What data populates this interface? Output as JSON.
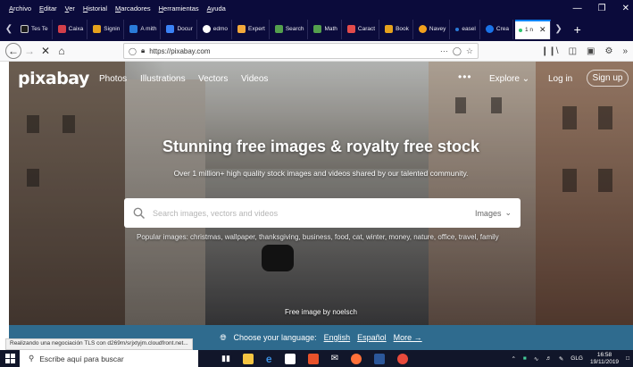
{
  "menubar": {
    "items": [
      "Archivo",
      "Editar",
      "Ver",
      "Historial",
      "Marcadores",
      "Herramientas",
      "Ayuda"
    ]
  },
  "tabs": [
    {
      "label": "Tes Te",
      "color": "#1b1b1b"
    },
    {
      "label": "Caixa",
      "color": "#d23f4a"
    },
    {
      "label": "Signin",
      "color": "#e5a21d"
    },
    {
      "label": "A mith",
      "color": "#2a7bd8"
    },
    {
      "label": "Docur",
      "color": "#3b82f6"
    },
    {
      "label": "edmo",
      "color": "#ffffff"
    },
    {
      "label": "Expert",
      "color": "#f3a93b"
    },
    {
      "label": "Search",
      "color": "#54a04d"
    },
    {
      "label": "Math",
      "color": "#54a04d"
    },
    {
      "label": "Caract",
      "color": "#e34b4b"
    },
    {
      "label": "Book",
      "color": "#e5a21d"
    },
    {
      "label": "Navey",
      "color": "#f2a11d"
    },
    {
      "label": "easel",
      "color": "#2a7bd8"
    },
    {
      "label": "Crea",
      "color": "#1a73e8"
    },
    {
      "label": "1 n",
      "color": "#2ec66e",
      "active": true
    }
  ],
  "navbar": {
    "url": "https://pixabay.com"
  },
  "site": {
    "logo": "pixabay",
    "nav": [
      "Photos",
      "Illustrations",
      "Vectors",
      "Videos"
    ],
    "explore": "Explore",
    "login": "Log in",
    "signup": "Sign up",
    "headline": "Stunning free images & royalty free stock",
    "subline": "Over 1 million+ high quality stock images and videos shared by our talented community.",
    "search_placeholder": "Search images, vectors and videos",
    "search_type": "Images",
    "popular": "Popular images: christmas, wallpaper, thanksgiving, business, food, cat, winter, money, nature, office, travel, family",
    "credit": "Free image by noelsch"
  },
  "langbar": {
    "prompt": "Choose your language:",
    "languages": [
      "English",
      "Español"
    ],
    "more": "More →"
  },
  "status": "Realizando una negociación TLS con d269m/srjxtyjm.cloudfront.net...",
  "taskbar": {
    "search_placeholder": "Escribe aquí para buscar",
    "lang": "GLG",
    "time": "16:58",
    "date": "19/11/2019"
  }
}
